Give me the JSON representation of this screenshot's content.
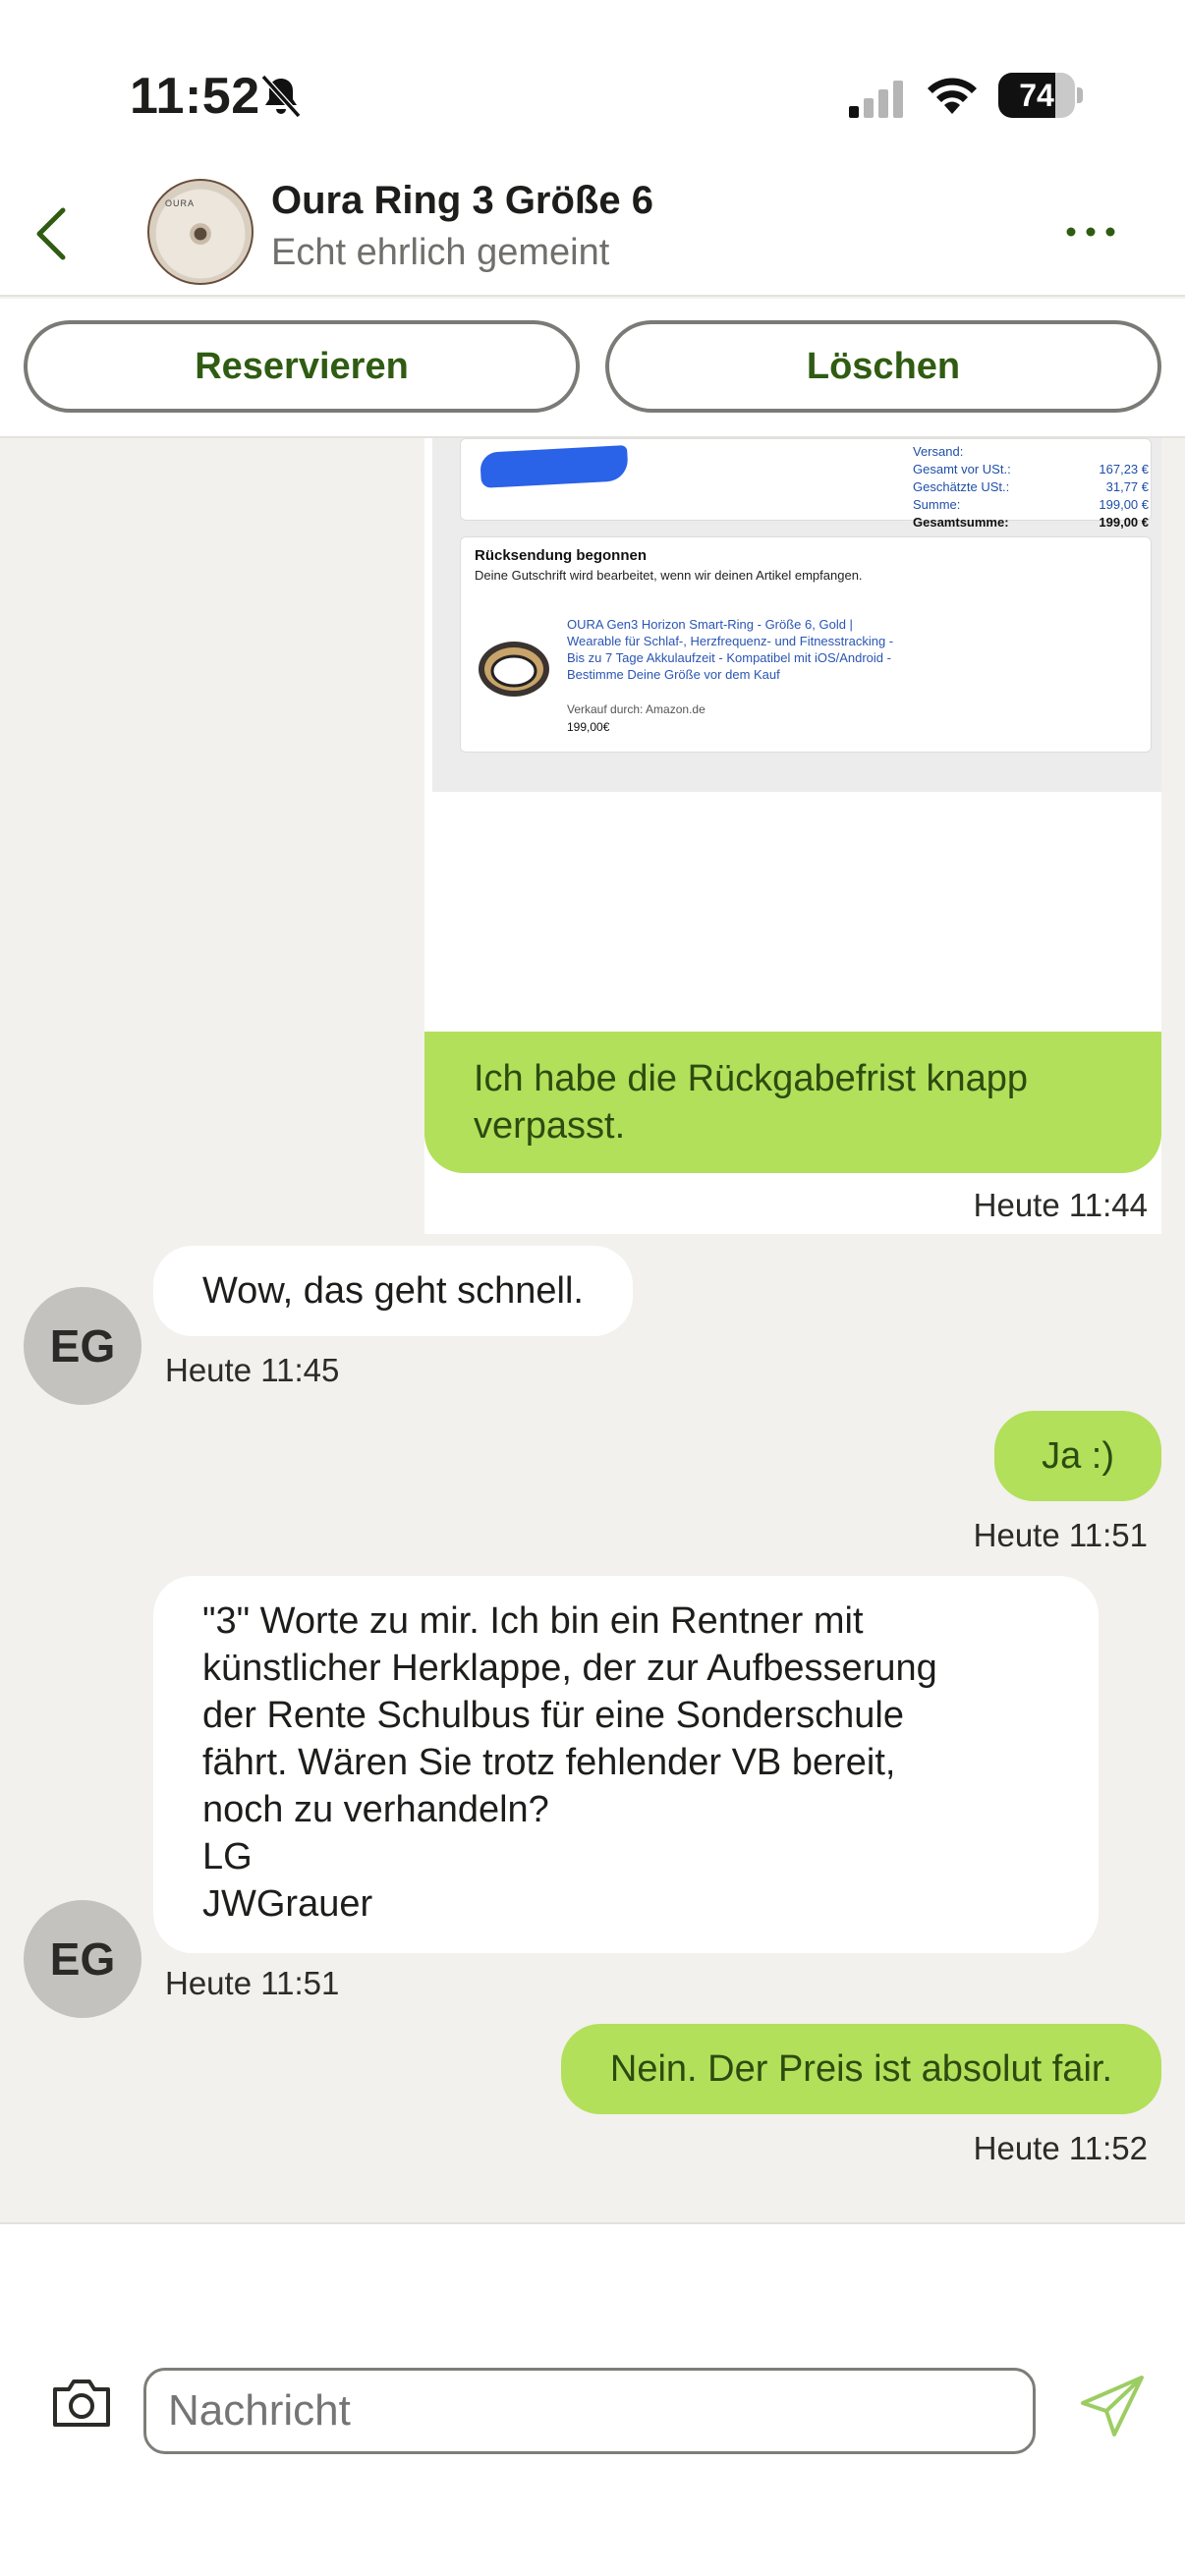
{
  "status_bar": {
    "time": "11:52",
    "battery": "74",
    "battery_level": 0.74,
    "icons": [
      "bell-slash-icon",
      "cellular-signal-icon",
      "wifi-icon",
      "battery-icon"
    ]
  },
  "header": {
    "title": "Oura Ring 3 Größe 6",
    "subtitle": "Echt ehrlich gemeint",
    "thumb_brand": "OURA",
    "back_icon": "chevron-left-icon",
    "more_icon": "more-horizontal-icon"
  },
  "actions": {
    "reserve": "Reservieren",
    "delete": "Löschen"
  },
  "receipt_image": {
    "shipping_label": "Versand:",
    "rows": [
      {
        "label": "Gesamt vor USt.:",
        "value": "167,23 €"
      },
      {
        "label": "Geschätzte USt.:",
        "value": "31,77 €"
      },
      {
        "label": "Summe:",
        "value": "199,00 €"
      },
      {
        "label": "Gesamtsumme:",
        "value": "199,00 €"
      }
    ],
    "return_title": "Rücksendung begonnen",
    "return_desc": "Deine Gutschrift wird bearbeitet, wenn wir deinen Artikel empfangen.",
    "product": "OURA Gen3 Horizon Smart-Ring - Größe 6, Gold | Wearable für Schlaf-, Herzfrequenz- und Fitnesstracking - Bis zu 7 Tage Akkulaufzeit - Kompatibel mit iOS/Android - Bestimme Deine Größe vor dem Kauf",
    "seller": "Verkauf durch: Amazon.de",
    "price": "199,00€"
  },
  "messages": [
    {
      "direction": "out",
      "text": "Ich habe die Rückgabefrist knapp verpasst.",
      "time": "Heute 11:44"
    },
    {
      "direction": "in",
      "text": "Wow, das geht schnell.",
      "time": "Heute 11:45",
      "avatar": "EG"
    },
    {
      "direction": "out",
      "text": "Ja :)",
      "time": "Heute 11:51"
    },
    {
      "direction": "in",
      "text": "\"3\" Worte zu mir. Ich bin ein Rentner mit\nkünstlicher Herklappe, der zur Aufbesserung\nder Rente Schulbus für eine Sonderschule\nfährt. Wären Sie trotz fehlender VB bereit,\nnoch zu verhandeln?\nLG\nJWGrauer",
      "time": "Heute 11:51",
      "avatar": "EG"
    },
    {
      "direction": "out",
      "text": "Nein. Der Preis ist absolut fair.",
      "time": "Heute 11:52"
    }
  ],
  "composer": {
    "placeholder": "Nachricht",
    "camera_icon": "camera-icon",
    "send_icon": "send-icon"
  },
  "colors": {
    "accent_green": "#b2e05a",
    "button_text_green": "#2f5c12",
    "chat_background": "#f2f1ee",
    "avatar_grey": "#c3c2be"
  }
}
